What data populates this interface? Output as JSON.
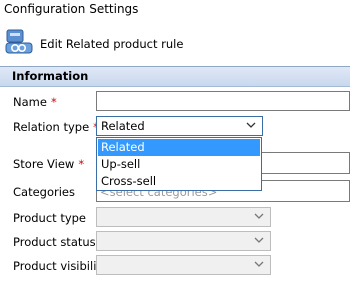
{
  "window": {
    "title": "Configuration Settings"
  },
  "header": {
    "title": "Edit Related product rule",
    "icon": "product-rule-icon"
  },
  "section": {
    "title": "Information"
  },
  "fields": {
    "name": {
      "label": "Name",
      "required": "*",
      "value": ""
    },
    "relation_type": {
      "label": "Relation type",
      "required": "*",
      "value": "Related"
    },
    "store_view": {
      "label": "Store View",
      "required": "*"
    },
    "categories": {
      "label": "Categories",
      "placeholder": "<select categories>"
    },
    "product_type": {
      "label": "Product type",
      "value": ""
    },
    "product_status": {
      "label": "Product status",
      "value": ""
    },
    "product_visibility": {
      "label": "Product visibility",
      "value": ""
    }
  },
  "dropdown": {
    "options": [
      "Related",
      "Up-sell",
      "Cross-sell"
    ],
    "selected": "Related"
  },
  "colors": {
    "required": "#d40000",
    "selection": "#3399ff",
    "section_header": "#c9d8ee"
  }
}
